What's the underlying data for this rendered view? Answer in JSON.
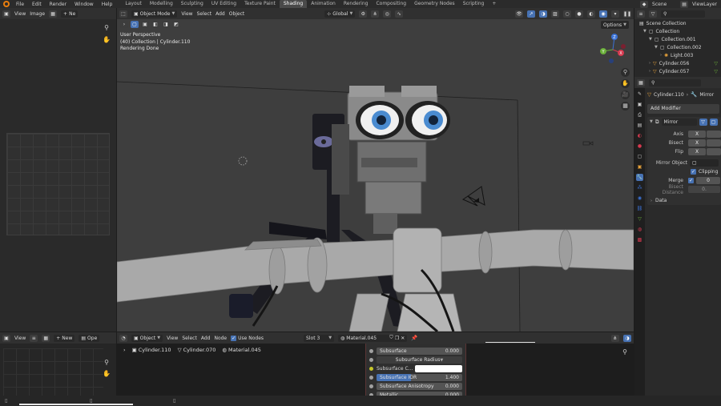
{
  "topbar": {
    "menus": [
      "File",
      "Edit",
      "Render",
      "Window",
      "Help"
    ],
    "workspaces": [
      "Layout",
      "Modelling",
      "Sculpting",
      "UV Editing",
      "Texture Paint",
      "Shading",
      "Animation",
      "Rendering",
      "Compositing",
      "Geometry Nodes",
      "Scripting"
    ],
    "active_workspace": "Shading",
    "add_tab": "+",
    "scene_label": "Scene",
    "viewlayer_label": "ViewLayer"
  },
  "image_editor": {
    "view_menu": "View",
    "image_menu": "Image",
    "new_label": "Ne"
  },
  "viewport": {
    "mode": "Object Mode",
    "menus": [
      "View",
      "Select",
      "Add",
      "Object"
    ],
    "transform_orientation": "Global",
    "options_label": "Options",
    "info_line1": "User Perspective",
    "info_line2": "(40) Collection | Cylinder.110",
    "info_line3": "Rendering Done",
    "gizmo": {
      "z": "Z",
      "y": "Y",
      "x": "X"
    }
  },
  "outliner": {
    "items": [
      {
        "label": "Scene Collection",
        "indent": 0
      },
      {
        "label": "Collection",
        "indent": 1
      },
      {
        "label": "Collection.001",
        "indent": 2
      },
      {
        "label": "Collection.002",
        "indent": 3
      },
      {
        "label": "Light.003",
        "indent": 4
      },
      {
        "label": "Cylinder.056",
        "indent": 2
      },
      {
        "label": "Cylinder.057",
        "indent": 2
      }
    ]
  },
  "properties": {
    "object_name": "Cylinder.110",
    "modifier_label": "Mirror",
    "add_modifier": "Add Modifier",
    "modifier_name": "Mirror",
    "axis_label": "Axis",
    "bisect_label": "Bisect",
    "flip_label": "Flip",
    "axis_value": "X",
    "bisect_value": "X",
    "flip_value": "X",
    "mirror_object_label": "Mirror Object",
    "clipping_label": "Clipping",
    "merge_label": "Merge",
    "merge_value": "0",
    "bisect_distance_label": "Bisect Distance",
    "bisect_distance_value": "0.",
    "data_label": "Data"
  },
  "node_editor": {
    "object_menu": "Object",
    "menus": [
      "View",
      "Select",
      "Add",
      "Node"
    ],
    "use_nodes": "Use Nodes",
    "slot": "Slot 3",
    "material": "Material.045",
    "breadcrumb": [
      "Cylinder.110",
      "Cylinder.070",
      "Material.045"
    ],
    "rows": [
      {
        "label": "Subsurface",
        "value": "0.000",
        "socket": "grey"
      },
      {
        "label": "Subsurface Radius",
        "value": "",
        "socket": "grey"
      },
      {
        "label": "Subsurface C...",
        "value": "",
        "socket": "yellow"
      },
      {
        "label": "Subsurface IOR",
        "value": "1.400",
        "socket": "grey"
      },
      {
        "label": "Subsurface Anisotropy",
        "value": "0.000",
        "socket": "grey"
      },
      {
        "label": "Metallic",
        "value": "0.000",
        "socket": "grey"
      }
    ]
  },
  "bottom_left": {
    "view_menu": "View",
    "new_label": "New",
    "open_label": "Ope"
  },
  "colors": {
    "accent_blue": "#4772b3",
    "active_tab": "#4a4a4a",
    "blender_orange": "#e87d0d",
    "selection": "#334d80"
  }
}
